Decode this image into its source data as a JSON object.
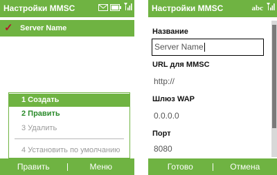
{
  "screen1": {
    "title": "Настройки MMSC",
    "icons": [
      "message-icon",
      "battery-icon",
      "signal-icon"
    ],
    "selected_item": "Server Name",
    "menu": [
      {
        "label": "1 Создать",
        "state": "selected"
      },
      {
        "label": "2 Править",
        "state": "enabled"
      },
      {
        "label": "3 Удалить",
        "state": "disabled"
      },
      {
        "label": "4 Установить по умолчанию",
        "state": "disabled"
      }
    ],
    "softkeys": {
      "left": "Править",
      "right": "Меню"
    }
  },
  "screen2": {
    "title": "Настройки MMSC",
    "input_mode": "abc",
    "fields": [
      {
        "label": "Название",
        "value": "Server Name",
        "editable": true
      },
      {
        "label": "URL для MMSC",
        "value": "http://"
      },
      {
        "label": "Шлюз WAP",
        "value": "0.0.0.0"
      },
      {
        "label": "Порт",
        "value": "8080"
      }
    ],
    "softkeys": {
      "left": "Готово",
      "right": "Отмена"
    }
  },
  "colors": {
    "accent": "#6fb342",
    "check": "#b4162e",
    "disabled": "#9a9a9a"
  }
}
